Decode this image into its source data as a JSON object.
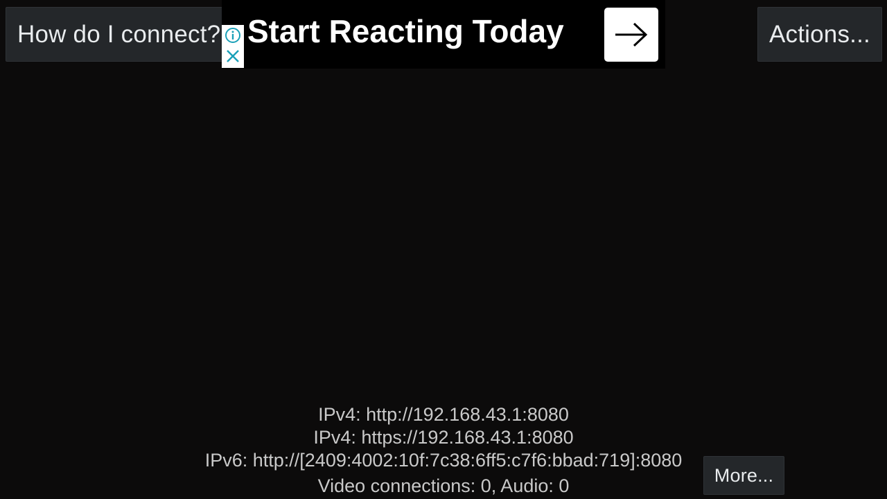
{
  "toolbar": {
    "connect_label": "How do I connect?",
    "actions_label": "Actions..."
  },
  "ad": {
    "headline": "Start Reacting Today",
    "info_icon": "info-icon",
    "close_icon": "close-icon",
    "arrow_icon": "arrow-right-icon",
    "accent_color": "#1aa0b8"
  },
  "status": {
    "ipv4_http": "IPv4: http://192.168.43.1:8080",
    "ipv4_https": "IPv4: https://192.168.43.1:8080",
    "ipv6_http": "IPv6: http://[2409:4002:10f:7c38:6ff5:c7f6:bbad:719]:8080",
    "connections": "Video connections: 0, Audio: 0"
  },
  "more_label": "More..."
}
